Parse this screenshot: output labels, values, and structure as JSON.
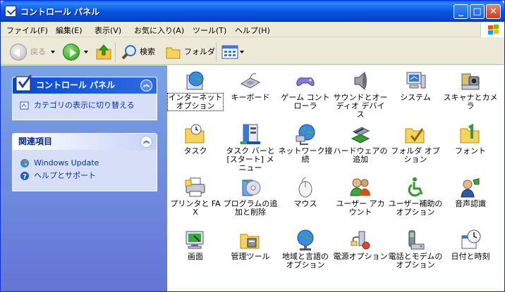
{
  "window": {
    "title": "コントロール パネル"
  },
  "menu": [
    "ファイル(F)",
    "編集(E)",
    "表示(V)",
    "お気に入り(A)",
    "ツール(T)",
    "ヘルプ(H)"
  ],
  "toolbar": {
    "back": "戻る",
    "search": "検索",
    "folders": "フォルダ"
  },
  "sidebar": {
    "control_panel": {
      "title": "コントロール パネル",
      "links": [
        "カテゴリの表示に切り替える"
      ]
    },
    "related": {
      "title": "関連項目",
      "links": [
        "Windows Update",
        "ヘルプとサポート"
      ]
    }
  },
  "items": [
    {
      "label": "インターネット オプション",
      "icon": "globe-icon"
    },
    {
      "label": "キーボード",
      "icon": "keyboard-icon"
    },
    {
      "label": "ゲーム コントローラ",
      "icon": "gamepad-icon"
    },
    {
      "label": "サウンドとオーディオ デバイス",
      "icon": "speaker-icon"
    },
    {
      "label": "システム",
      "icon": "computer-icon"
    },
    {
      "label": "スキャナとカメラ",
      "icon": "scanner-icon"
    },
    {
      "label": "タスク",
      "icon": "task-folder-icon"
    },
    {
      "label": "タスク バーと [スタート] メニュー",
      "icon": "taskbar-icon"
    },
    {
      "label": "ネットワーク接続",
      "icon": "network-icon"
    },
    {
      "label": "ハードウェアの追加",
      "icon": "hardware-icon"
    },
    {
      "label": "フォルダ オプション",
      "icon": "folder-options-icon"
    },
    {
      "label": "フォント",
      "icon": "fonts-folder-icon"
    },
    {
      "label": "プリンタと FAX",
      "icon": "printer-icon"
    },
    {
      "label": "プログラムの追加と削除",
      "icon": "programs-icon"
    },
    {
      "label": "マウス",
      "icon": "mouse-icon"
    },
    {
      "label": "ユーザー アカウント",
      "icon": "users-icon"
    },
    {
      "label": "ユーザー補助の オプション",
      "icon": "accessibility-icon"
    },
    {
      "label": "音声認識",
      "icon": "speech-icon"
    },
    {
      "label": "画面",
      "icon": "display-icon"
    },
    {
      "label": "管理ツール",
      "icon": "admin-tools-icon"
    },
    {
      "label": "地域と言語の オプション",
      "icon": "globe-regional-icon"
    },
    {
      "label": "電源オプション",
      "icon": "power-icon"
    },
    {
      "label": "電話とモデムの オプション",
      "icon": "phone-modem-icon"
    },
    {
      "label": "日付と時刻",
      "icon": "clock-icon"
    }
  ]
}
